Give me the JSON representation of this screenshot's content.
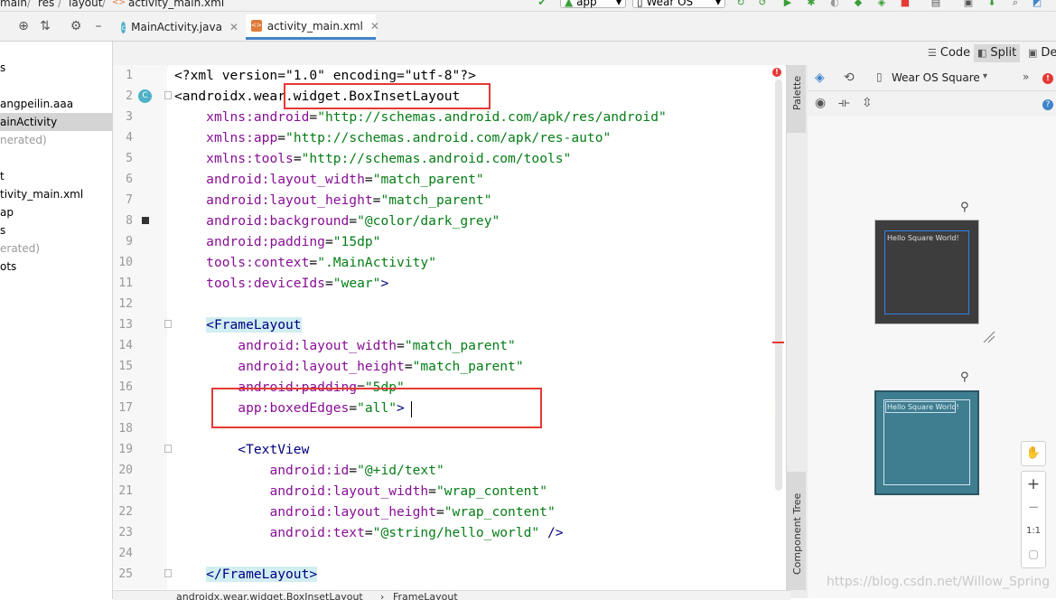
{
  "breadcrumb": {
    "main": "main",
    "res": "res",
    "layout": "layout",
    "file": "activity_main.xml",
    "sep": "/"
  },
  "toolbar": {
    "run_config": "app",
    "device": "Wear OS"
  },
  "tabs": [
    {
      "label": "MainActivity.java",
      "icon": "class-icon",
      "active": false
    },
    {
      "label": "activity_main.xml",
      "icon": "xml-file-icon",
      "active": true
    }
  ],
  "project_items": [
    {
      "label": "s",
      "gray": false,
      "selected": false
    },
    {
      "label": "angpeilin.aaa",
      "gray": false,
      "selected": false
    },
    {
      "label": "ainActivity",
      "gray": false,
      "selected": true
    },
    {
      "label": "nerated)",
      "gray": true,
      "selected": false
    },
    {
      "label": "t",
      "gray": false,
      "selected": false
    },
    {
      "label": "tivity_main.xml",
      "gray": false,
      "selected": false
    },
    {
      "label": "ap",
      "gray": false,
      "selected": false
    },
    {
      "label": "s",
      "gray": false,
      "selected": false
    },
    {
      "label": "erated)",
      "gray": true,
      "selected": false
    },
    {
      "label": "ots",
      "gray": false,
      "selected": false
    }
  ],
  "view_modes": {
    "code": "Code",
    "split": "Split",
    "design": "Des"
  },
  "design_toolbar": {
    "device_label": "Wear OS Square"
  },
  "side_tabs": {
    "palette": "Palette",
    "component_tree": "Component Tree"
  },
  "line_numbers": [
    "1",
    "2",
    "3",
    "4",
    "5",
    "6",
    "7",
    "8",
    "9",
    "10",
    "11",
    "12",
    "13",
    "14",
    "15",
    "16",
    "17",
    "18",
    "19",
    "20",
    "21",
    "22",
    "23",
    "24",
    "25"
  ],
  "code": {
    "l1": {
      "a": "<?xml version=\"1.0\" encoding=\"utf-8\"?>"
    },
    "l2": {
      "a": "<androidx.wear.widget.BoxInsetLayout"
    },
    "l3": {
      "attr": "xmlns:android",
      "val": "\"http://schemas.android.com/apk/res/android\""
    },
    "l4": {
      "attr": "xmlns:app",
      "val": "\"http://schemas.android.com/apk/res-auto\""
    },
    "l5": {
      "attr": "xmlns:tools",
      "val": "\"http://schemas.android.com/tools\""
    },
    "l6": {
      "attr": "android:layout_width",
      "val": "\"match_parent\""
    },
    "l7": {
      "attr": "android:layout_height",
      "val": "\"match_parent\""
    },
    "l8": {
      "attr": "android:background",
      "val": "\"@color/dark_grey\""
    },
    "l9": {
      "attr": "android:padding",
      "val": "\"15dp\""
    },
    "l10": {
      "attr": "tools:context",
      "val": "\".MainActivity\""
    },
    "l11": {
      "attr": "tools:deviceIds",
      "val": "\"wear\"",
      "end": ">"
    },
    "l13": {
      "tag": "<FrameLayout"
    },
    "l14": {
      "attr": "android:layout_width",
      "val": "\"match_parent\""
    },
    "l15": {
      "attr": "android:layout_height",
      "val": "\"match_parent\""
    },
    "l16": {
      "attr": "android:padding",
      "val": "\"5dp\""
    },
    "l17": {
      "attr": "app:boxedEdges",
      "val": "\"all\"",
      "end": ">"
    },
    "l19": {
      "tag": "<TextView"
    },
    "l20": {
      "attr": "android:id",
      "val": "\"@+id/text\""
    },
    "l21": {
      "attr": "android:layout_width",
      "val": "\"wrap_content\""
    },
    "l22": {
      "attr": "android:layout_height",
      "val": "\"wrap_content\""
    },
    "l23": {
      "attr": "android:text",
      "val": "\"@string/hello_world\"",
      "end": " />"
    },
    "l25": {
      "tag": "</FrameLayout>"
    },
    "eq": "="
  },
  "preview": {
    "text1": "Hello Square World!",
    "text2": "Hello Square World!"
  },
  "zoom": {
    "plus": "+",
    "minus": "−",
    "ratio": "1:1"
  },
  "status_path": {
    "p1": "androidx.wear.widget.BoxInsetLayout",
    "sep": "›",
    "p2": "FrameLayout"
  },
  "watermark": "https://blog.csdn.net/Willow_Spring",
  "colors": {
    "accent": "#4083c9",
    "highlight_box": "#e53935",
    "preview_dark": "#3d3d3d",
    "preview_blueprint": "#3f7d90"
  }
}
